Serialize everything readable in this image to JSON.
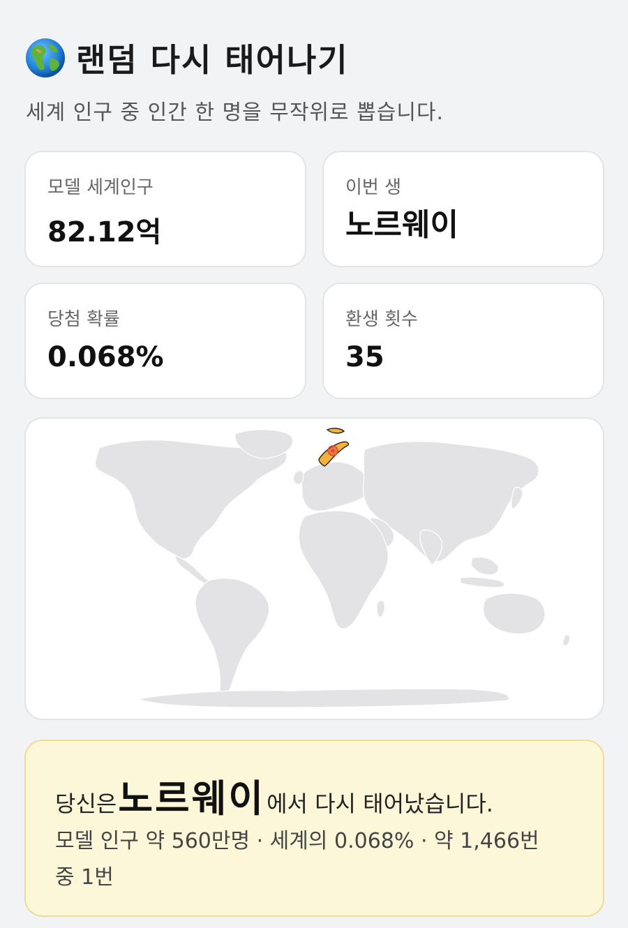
{
  "header": {
    "icon": "globe-icon",
    "title": "랜덤 다시 태어나기",
    "subtitle": "세계 인구 중 인간 한 명을 무작위로 뽑습니다."
  },
  "stats": {
    "population": {
      "label": "모델 세계인구",
      "value": "82.12억"
    },
    "this_life": {
      "label": "이번 생",
      "value": "노르웨이"
    },
    "probability": {
      "label": "당첨 확률",
      "value": "0.068%"
    },
    "rebirths": {
      "label": "환생 횟수",
      "value": "35"
    }
  },
  "map": {
    "highlighted_country": "노르웨이",
    "highlight_color": "#f4b13d",
    "marker_color": "#e0473a",
    "land_color": "#e3e3e6"
  },
  "result": {
    "prefix": "당신은 ",
    "country": "노르웨이",
    "suffix": "에서 다시 태어났습니다.",
    "detail_line1": "모델 인구 약 560만명 · 세계의 0.068% · 약 1,466번",
    "detail_line2": "중 1번"
  }
}
